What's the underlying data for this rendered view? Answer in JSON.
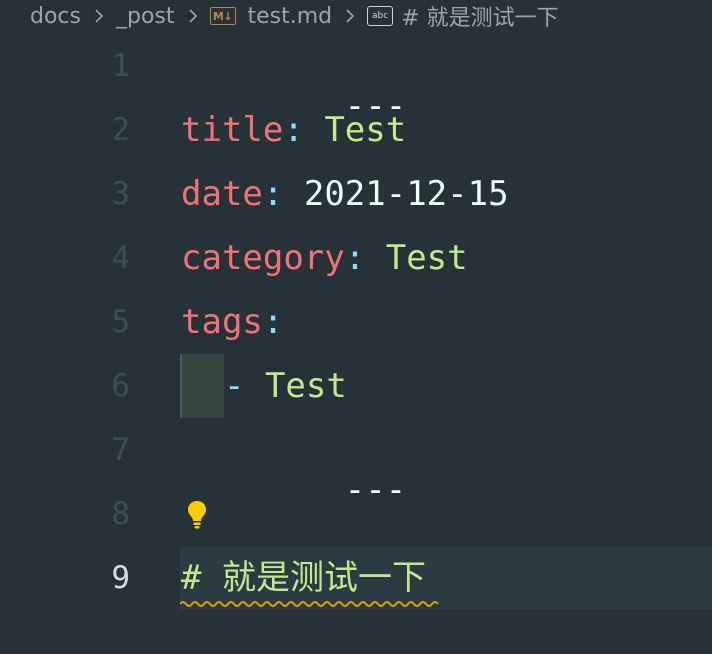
{
  "breadcrumb": {
    "items": [
      {
        "label": "docs"
      },
      {
        "label": "_post"
      },
      {
        "label": "test.md",
        "icon": "markdown-icon",
        "icon_text": "M↓"
      },
      {
        "label": "# 就是测试一下",
        "icon": "abc-symbol-icon",
        "icon_text": "abc"
      }
    ]
  },
  "editor": {
    "line_numbers": [
      "1",
      "2",
      "3",
      "4",
      "5",
      "6",
      "7",
      "8",
      "9"
    ],
    "current_line": "9",
    "lines": {
      "l1": {
        "text": "---"
      },
      "l2": {
        "key": "title",
        "colon": ":",
        "value": " Test"
      },
      "l3": {
        "key": "date",
        "colon": ":",
        "value": " 2021-12-15"
      },
      "l4": {
        "key": "category",
        "colon": ":",
        "value": " Test"
      },
      "l5": {
        "key": "tags",
        "colon": ":"
      },
      "l6": {
        "dash": "- ",
        "value": "Test"
      },
      "l7": {
        "text": "---"
      },
      "l9": {
        "hash": "#",
        "value": " 就是测试一下"
      }
    },
    "lightbulb_icon": "lightbulb-icon"
  },
  "colors": {
    "background": "#263238",
    "key": "#f07178",
    "string": "#c3e88d",
    "punctuation": "#89ddff",
    "text": "#eeffff",
    "lightbulb": "#ffcc00",
    "squiggle": "#d7a300"
  }
}
